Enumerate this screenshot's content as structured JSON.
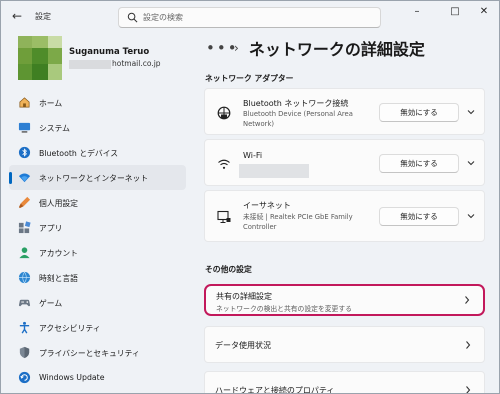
{
  "titlebar": {
    "app_title": "設定",
    "search_placeholder": "設定の検索",
    "back_glyph": "←",
    "minimize_glyph": "–",
    "maximize_glyph": "□",
    "close_glyph": "✕"
  },
  "profile": {
    "name": "Suganuma Teruo",
    "email_suffix": "hotmail.co.jp"
  },
  "sidebar": {
    "items": [
      {
        "label": "ホーム",
        "icon": "home-icon",
        "active": false
      },
      {
        "label": "システム",
        "icon": "system-icon",
        "active": false
      },
      {
        "label": "Bluetooth とデバイス",
        "icon": "bluetooth-icon",
        "active": false
      },
      {
        "label": "ネットワークとインターネット",
        "icon": "wifi-icon",
        "active": true
      },
      {
        "label": "個人用設定",
        "icon": "brush-icon",
        "active": false
      },
      {
        "label": "アプリ",
        "icon": "apps-icon",
        "active": false
      },
      {
        "label": "アカウント",
        "icon": "account-icon",
        "active": false
      },
      {
        "label": "時刻と言語",
        "icon": "time-language-icon",
        "active": false
      },
      {
        "label": "ゲーム",
        "icon": "game-icon",
        "active": false
      },
      {
        "label": "アクセシビリティ",
        "icon": "accessibility-icon",
        "active": false
      },
      {
        "label": "プライバシーとセキュリティ",
        "icon": "shield-icon",
        "active": false
      },
      {
        "label": "Windows Update",
        "icon": "update-icon",
        "active": false
      }
    ]
  },
  "main": {
    "breadcrumb_dots": "•••",
    "breadcrumb_sep": "›",
    "page_title": "ネットワークの詳細設定",
    "adapters_section": "ネットワーク アダプター",
    "adapters": [
      {
        "title": "Bluetooth ネットワーク接続",
        "subtitle": "Bluetooth Device (Personal Area Network)",
        "button": "無効にする",
        "icon": "ethernet-icon"
      },
      {
        "title": "Wi-Fi",
        "subtitle": "",
        "button": "無効にする",
        "icon": "wifi-icon"
      },
      {
        "title": "イーサネット",
        "subtitle": "未接続 | Realtek PCIe GbE Family Controller",
        "button": "無効にする",
        "icon": "monitor-network-icon"
      }
    ],
    "other_section": "その他の設定",
    "links": [
      {
        "title": "共有の詳細設定",
        "subtitle": "ネットワークの検出と共有の設定を変更する"
      },
      {
        "title": "データ使用状況",
        "subtitle": ""
      },
      {
        "title": "ハードウェアと接続のプロパティ",
        "subtitle": ""
      }
    ]
  },
  "colors": {
    "accent": "#0067c0",
    "highlight_border": "#c2185b",
    "window_bg": "#eff2f6",
    "card_bg": "#fbfbfb"
  }
}
